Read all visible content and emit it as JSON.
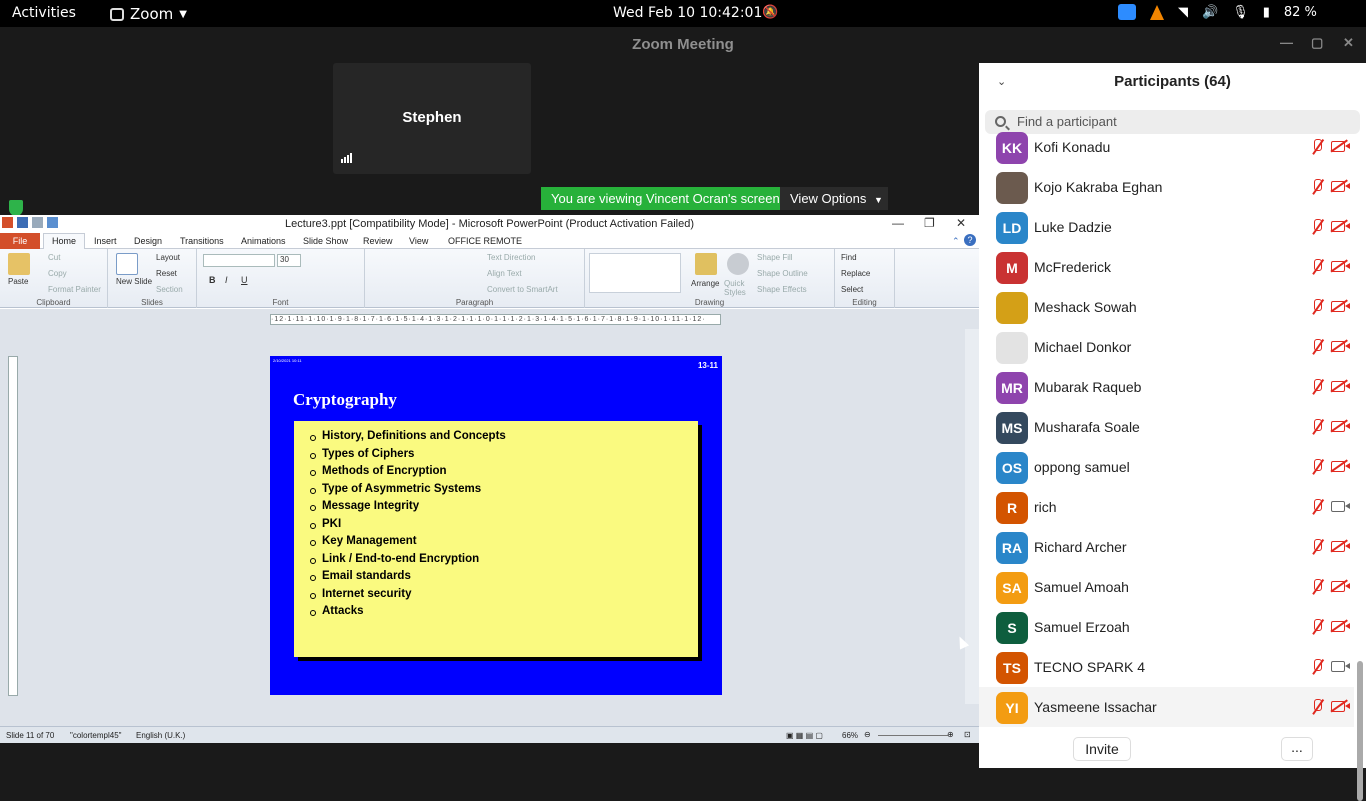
{
  "topbar": {
    "activities": "Activities",
    "app_name": "Zoom",
    "clock": "Wed Feb 10  10:42:01",
    "battery": "82 %"
  },
  "window": {
    "title": "Zoom Meeting"
  },
  "meeting": {
    "tile_name": "Stephen",
    "banner": "You are viewing Vincent Ocran's screen",
    "view_options": "View Options"
  },
  "ppt": {
    "title": "Lecture3.ppt [Compatibility Mode]  -  Microsoft PowerPoint (Product Activation Failed)",
    "tabs": [
      "File",
      "Home",
      "Insert",
      "Design",
      "Transitions",
      "Animations",
      "Slide Show",
      "Review",
      "View",
      "OFFICE REMOTE"
    ],
    "ribbon": {
      "clipboard": {
        "label": "Clipboard",
        "paste": "Paste",
        "cut": "Cut",
        "copy": "Copy",
        "format_painter": "Format Painter"
      },
      "slides": {
        "label": "Slides",
        "new_slide": "New Slide",
        "layout": "Layout",
        "reset": "Reset",
        "section": "Section"
      },
      "font": {
        "label": "Font",
        "size": "30"
      },
      "paragraph": {
        "label": "Paragraph",
        "text_direction": "Text Direction",
        "align_text": "Align Text",
        "convert": "Convert to SmartArt"
      },
      "drawing": {
        "label": "Drawing",
        "arrange": "Arrange",
        "quick_styles": "Quick Styles",
        "shape_fill": "Shape Fill",
        "shape_outline": "Shape Outline",
        "shape_effects": "Shape Effects"
      },
      "editing": {
        "label": "Editing",
        "find": "Find",
        "replace": "Replace",
        "select": "Select"
      }
    },
    "ruler": "·12·1·11·1·10·1·9·1·8·1·7·1·6·1·5·1·4·1·3·1·2·1·1·1·0·1·1·1·2·1·3·1·4·1·5·1·6·1·7·1·8·1·9·1·10·1·11·1·12·",
    "slide": {
      "date": "2/10/2021   10:11",
      "number": "13-11",
      "title": "Cryptography",
      "bullets": [
        "History, Definitions and Concepts",
        "Types of Ciphers",
        "Methods of Encryption",
        "Type of Asymmetric  Systems",
        "Message Integrity",
        "PKI",
        "Key Management",
        "Link / End-to-end Encryption",
        "Email standards",
        "Internet security",
        "Attacks"
      ]
    },
    "status": {
      "slide_info": "Slide 11 of 70",
      "theme": "\"colortempl45\"",
      "language": "English (U.K.)",
      "zoom": "66%"
    }
  },
  "participants": {
    "header": "Participants (64)",
    "search_placeholder": "Find a participant",
    "list": [
      {
        "initials": "KK",
        "name": "Kofi Konadu",
        "color": "#8e44ad",
        "cam_on": false
      },
      {
        "initials": "",
        "name": "Kojo Kakraba Eghan",
        "color": "#6b5a4e",
        "cam_on": false
      },
      {
        "initials": "LD",
        "name": "Luke Dadzie",
        "color": "#2a86c9",
        "cam_on": false
      },
      {
        "initials": "M",
        "name": "McFrederick",
        "color": "#c93232",
        "cam_on": false
      },
      {
        "initials": "",
        "name": "Meshack Sowah",
        "color": "#d4a017",
        "cam_on": false
      },
      {
        "initials": "",
        "name": "Michael Donkor",
        "color": "#e3e3e3",
        "cam_on": false
      },
      {
        "initials": "MR",
        "name": "Mubarak Raqueb",
        "color": "#8e44ad",
        "cam_on": false
      },
      {
        "initials": "MS",
        "name": "Musharafa Soale",
        "color": "#34495e",
        "cam_on": false
      },
      {
        "initials": "OS",
        "name": "oppong samuel",
        "color": "#2a86c9",
        "cam_on": false
      },
      {
        "initials": "R",
        "name": "rich",
        "color": "#d35400",
        "cam_on": true
      },
      {
        "initials": "RA",
        "name": "Richard Archer",
        "color": "#2a86c9",
        "cam_on": false
      },
      {
        "initials": "SA",
        "name": "Samuel Amoah",
        "color": "#f39c12",
        "cam_on": false
      },
      {
        "initials": "S",
        "name": "Samuel Erzoah",
        "color": "#0e5e3e",
        "cam_on": false
      },
      {
        "initials": "TS",
        "name": "TECNO SPARK 4",
        "color": "#d35400",
        "cam_on": true
      },
      {
        "initials": "YI",
        "name": "Yasmeene Issachar",
        "color": "#f39c12",
        "cam_on": false
      }
    ],
    "invite": "Invite",
    "more": "..."
  }
}
